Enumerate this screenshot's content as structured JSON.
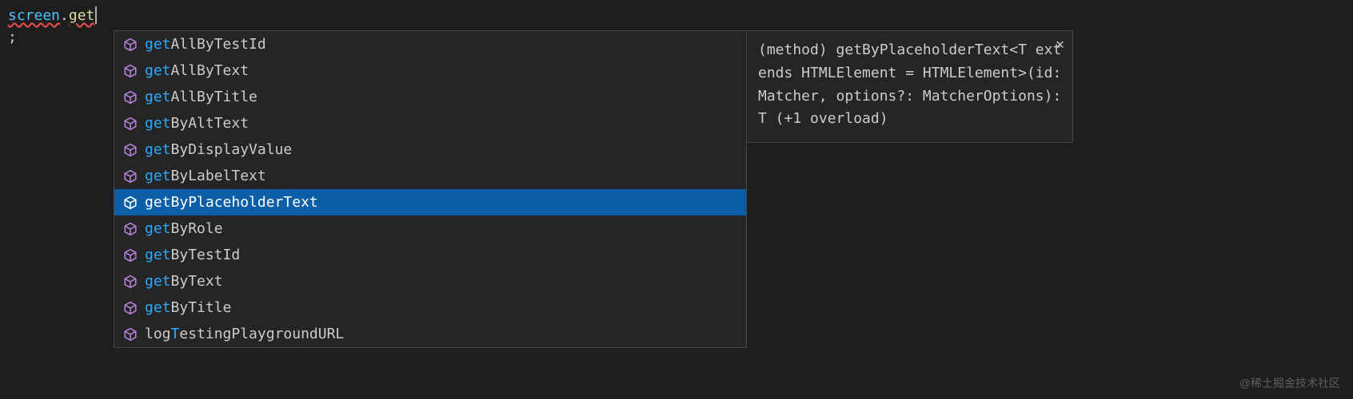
{
  "editor": {
    "line1_var": "screen",
    "line1_dot": ".",
    "line1_method": "get",
    "line2": ";"
  },
  "suggest": {
    "selected_index": 6,
    "items": [
      {
        "prefix": "get",
        "rest": "AllByTestId",
        "kind": "method"
      },
      {
        "prefix": "get",
        "rest": "AllByText",
        "kind": "method"
      },
      {
        "prefix": "get",
        "rest": "AllByTitle",
        "kind": "method"
      },
      {
        "prefix": "get",
        "rest": "ByAltText",
        "kind": "method"
      },
      {
        "prefix": "get",
        "rest": "ByDisplayValue",
        "kind": "method"
      },
      {
        "prefix": "get",
        "rest": "ByLabelText",
        "kind": "method"
      },
      {
        "prefix": "get",
        "rest": "ByPlaceholderText",
        "kind": "method"
      },
      {
        "prefix": "get",
        "rest": "ByRole",
        "kind": "method"
      },
      {
        "prefix": "get",
        "rest": "ByTestId",
        "kind": "method"
      },
      {
        "prefix": "get",
        "rest": "ByText",
        "kind": "method"
      },
      {
        "prefix": "get",
        "rest": "ByTitle",
        "kind": "method"
      },
      {
        "prefix": "",
        "rest_before": "log",
        "match_mid": "T",
        "rest_after": "estingPlaygroundURL",
        "kind": "method"
      }
    ]
  },
  "details": {
    "signature": "(method) getByPlaceholderText<T extends HTMLElement = HTMLElement>(id: Matcher, options?: MatcherOptions): T (+1 overload)",
    "close_label": "✕"
  },
  "watermark": "@稀土掘金技术社区"
}
